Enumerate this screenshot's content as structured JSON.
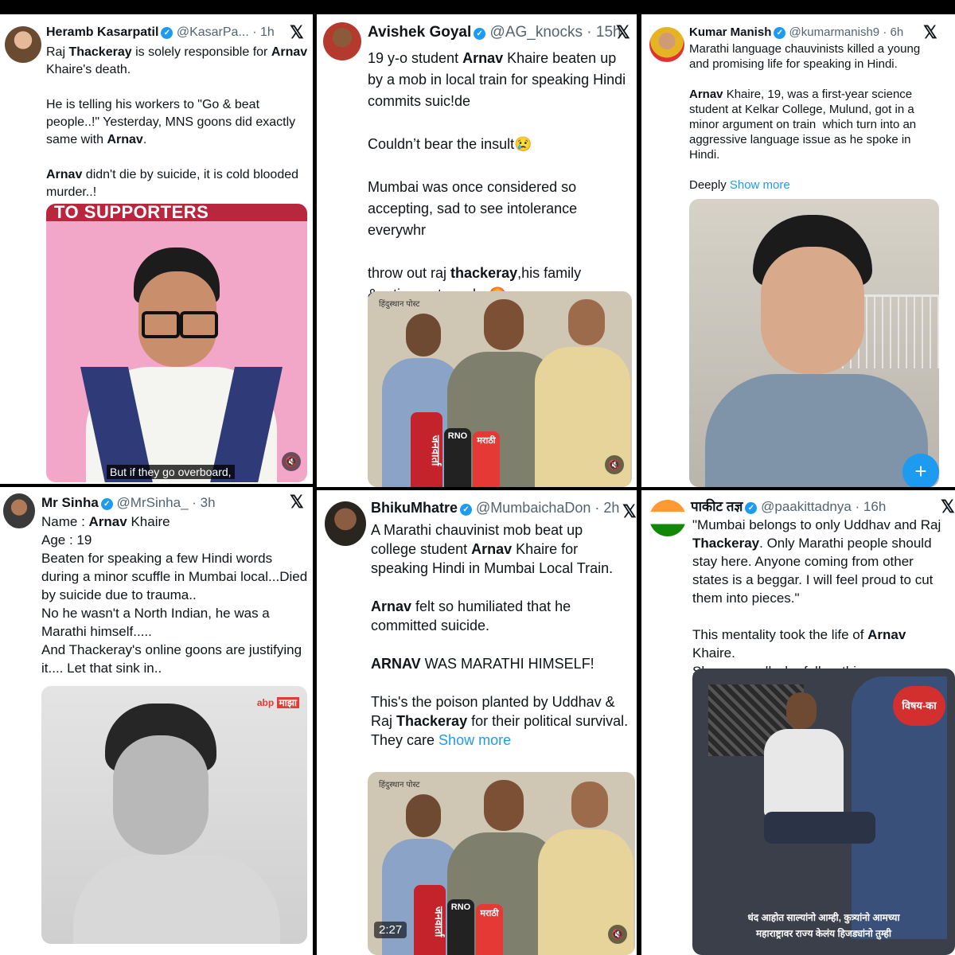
{
  "posts": [
    {
      "name": "Heramb Kasarpatil",
      "handle": "@KasarPa...",
      "time": "· 1h",
      "text_parts": [
        {
          "t": "Raj "
        },
        {
          "t": "Thackeray",
          "b": true
        },
        {
          "t": " is solely responsible for "
        },
        {
          "t": "Arnav",
          "b": true
        },
        {
          "t": " Khaire's death.\n\nHe is telling his workers to \"Go & beat people..!\" Yesterday, MNS goons did exactly same with "
        },
        {
          "t": "Arnav",
          "b": true
        },
        {
          "t": ".\n\n"
        },
        {
          "t": "Arnav",
          "b": true
        },
        {
          "t": " didn't die by suicide, it is cold blooded murder..!"
        }
      ],
      "media": {
        "banner": "TO SUPPORTERS",
        "caption": "But if they go overboard,"
      }
    },
    {
      "name": "Avishek Goyal",
      "handle": "@AG_knocks",
      "time": "· 15h",
      "text_parts": [
        {
          "t": "19 y-o student "
        },
        {
          "t": "Arnav",
          "b": true
        },
        {
          "t": " Khaire beaten up by a mob in local train for speaking Hindi commits suic!de\n\nCouldn’t bear the insult😢\n\nMumbai was once considered so accepting, sad to see intolerance everywhr\n\nthrow out raj "
        },
        {
          "t": "thackeray",
          "b": true
        },
        {
          "t": ",his family &entire party cadre😡"
        }
      ],
      "media": {
        "logo": "हिंदुस्थान पोस्ट",
        "mic_labels": [
          "जनवार्ता",
          "RNO",
          "मराठी"
        ]
      }
    },
    {
      "name": "Kumar Manish",
      "handle": "@kumarmanish9",
      "time": "· 6h",
      "text_parts": [
        {
          "t": "Marathi language chauvinists killed a young and promising life for speaking in Hindi.\n\n"
        },
        {
          "t": "Arnav",
          "b": true
        },
        {
          "t": " Khaire, 19, was a first-year science student at Kelkar College, Mulund, got in a minor argument on train  which turn into an aggressive language issue as he spoke in Hindi.\n\nDeeply "
        },
        {
          "t": "Show more",
          "link": true
        }
      ],
      "media": {
        "fab": "+"
      }
    },
    {
      "name": "Mr Sinha",
      "handle": "@MrSinha_",
      "time": "· 3h",
      "text_parts": [
        {
          "t": "Name : "
        },
        {
          "t": "Arnav",
          "b": true
        },
        {
          "t": " Khaire\nAge : 19\nBeaten for speaking a few Hindi words during a minor scuffle in Mumbai local...Died by suicide due to trauma..\nNo he wasn't a North Indian, he was a Marathi himself.....\nAnd Thackeray's online goons are justifying it.... Let that sink in.."
        }
      ],
      "media": {
        "badge_abp": "abp",
        "badge_majha": "माझा"
      }
    },
    {
      "name": "BhikuMhatre",
      "handle": "@MumbaichaDon",
      "time": "· 2h",
      "text_parts": [
        {
          "t": "A Marathi chauvinist mob beat up college student "
        },
        {
          "t": "Arnav",
          "b": true
        },
        {
          "t": " Khaire for speaking Hindi in Mumbai Local Train.\n\n"
        },
        {
          "t": "Arnav",
          "b": true
        },
        {
          "t": " felt so humiliated that he committed suicide.\n\n"
        },
        {
          "t": "ARNAV",
          "b": true
        },
        {
          "t": " WAS MARATHI HIMSELF!\n\nThis's the poison planted by Uddhav & Raj "
        },
        {
          "t": "Thackeray",
          "b": true
        },
        {
          "t": " for their political survival. They care "
        },
        {
          "t": "Show more",
          "link": true
        }
      ],
      "media": {
        "logo": "हिंदुस्थान पोस्ट",
        "duration": "2:27",
        "mic_labels": [
          "जनवार्ता",
          "RNO",
          "मराठी"
        ]
      }
    },
    {
      "name": "पाकीट तज्ञ",
      "handle": "@paakittadnya",
      "time": "· 16h",
      "text_parts": [
        {
          "t": "\"Mumbai belongs to only Uddhav and Raj "
        },
        {
          "t": "Thackeray",
          "b": true
        },
        {
          "t": ". Only Marathi people should stay here. Anyone coming from other states is a beggar. I will feel proud to cut them into pieces.\"\n\nThis mentality took the life of "
        },
        {
          "t": "Arnav",
          "b": true
        },
        {
          "t": " Khaire.\nShame on all who follow this."
        }
      ],
      "media": {
        "logo": "विषय-का",
        "caption_line1": "धंद आहोत साल्यांनो आम्ही, कुत्र्यांनो आमच्या",
        "caption_line2": "महाराष्ट्रावर राज्य केलंय हिजड्यांनो तुम्ही"
      }
    }
  ],
  "icons": {
    "x": "𝕏",
    "speaker": "🔇",
    "verified": "✓"
  },
  "colors": {
    "link": "#1d9bf0",
    "verified": "#1d9bf0",
    "background": "#000000"
  }
}
